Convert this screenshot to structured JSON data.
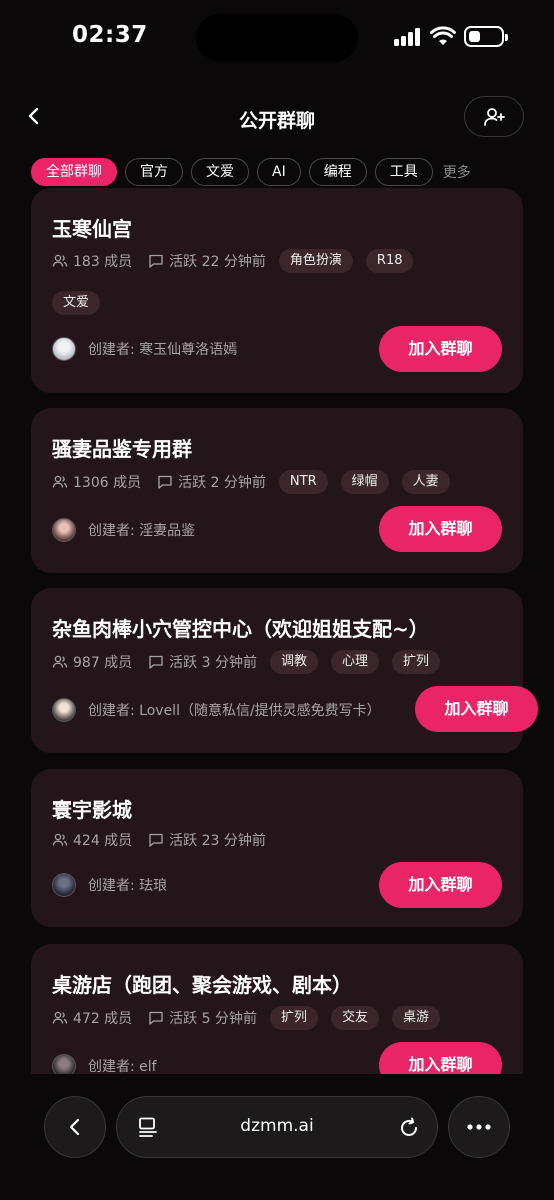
{
  "status_bar": {
    "time": "02:37"
  },
  "header": {
    "title": "公开群聊"
  },
  "filters": {
    "chips": [
      "全部群聊",
      "官方",
      "文爱",
      "AI",
      "编程",
      "工具"
    ],
    "active_index": 0,
    "more": "更多"
  },
  "groups": [
    {
      "name": "玉寒仙宫",
      "members": "183 成员",
      "active": "活跃 22 分钟前",
      "tags": [
        "角色扮演",
        "R18"
      ],
      "extra_tags": [
        "文爱"
      ],
      "creator": "创建者: 寒玉仙尊洛语嫣",
      "join_label": "加入群聊"
    },
    {
      "name": "骚妻品鉴专用群",
      "members": "1306 成员",
      "active": "活跃 2 分钟前",
      "tags": [
        "NTR",
        "绿帽",
        "人妻"
      ],
      "extra_tags": [],
      "creator": "创建者: 淫妻品鉴",
      "join_label": "加入群聊"
    },
    {
      "name": "杂鱼肉棒小穴管控中心（欢迎姐姐支配~）",
      "members": "987 成员",
      "active": "活跃 3 分钟前",
      "tags": [
        "调教",
        "心理",
        "扩列"
      ],
      "extra_tags": [],
      "creator": "创建者: Lovell（随意私信/提供灵感免费写卡）",
      "join_label": "加入群聊"
    },
    {
      "name": "寰宇影城",
      "members": "424 成员",
      "active": "活跃 23 分钟前",
      "tags": [],
      "extra_tags": [],
      "creator": "创建者: 珐琅",
      "join_label": "加入群聊"
    },
    {
      "name": "桌游店（跑团、聚会游戏、剧本）",
      "members": "472 成员",
      "active": "活跃 5 分钟前",
      "tags": [
        "扩列",
        "交友",
        "桌游"
      ],
      "extra_tags": [],
      "creator": "创建者: elf",
      "join_label": "加入群聊"
    }
  ],
  "browser": {
    "url": "dzmm.ai"
  },
  "colors": {
    "accent": "#ea2567",
    "card": "#231519",
    "tag": "#3a262b",
    "background": "#0b0809"
  },
  "icons": {
    "back": "chevron-left-icon",
    "add_user": "user-plus-icon",
    "members": "users-icon",
    "activity": "message-square-icon",
    "reader": "reader-mode-icon",
    "reload": "reload-icon",
    "more": "ellipsis-icon"
  }
}
